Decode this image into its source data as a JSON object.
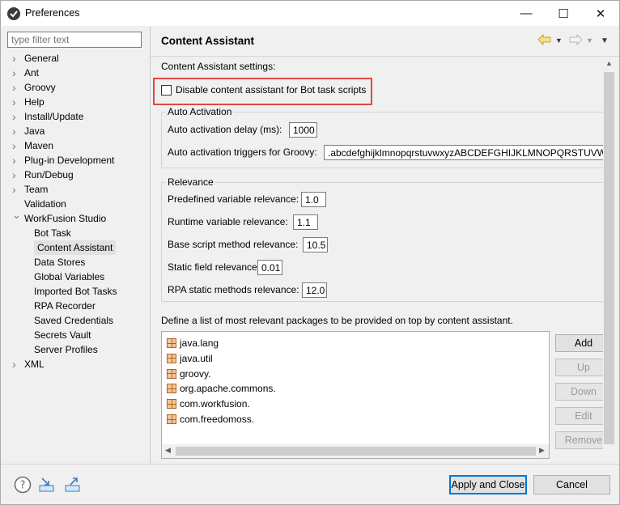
{
  "window": {
    "title": "Preferences",
    "min": "—",
    "max": "☐",
    "close": "✕"
  },
  "sidebar": {
    "filter_placeholder": "type filter text",
    "items": [
      {
        "label": "General",
        "has_children": true
      },
      {
        "label": "Ant",
        "has_children": true
      },
      {
        "label": "Groovy",
        "has_children": true
      },
      {
        "label": "Help",
        "has_children": true
      },
      {
        "label": "Install/Update",
        "has_children": true
      },
      {
        "label": "Java",
        "has_children": true
      },
      {
        "label": "Maven",
        "has_children": true
      },
      {
        "label": "Plug-in Development",
        "has_children": true
      },
      {
        "label": "Run/Debug",
        "has_children": true
      },
      {
        "label": "Team",
        "has_children": true
      },
      {
        "label": "Validation",
        "has_children": false
      },
      {
        "label": "WorkFusion Studio",
        "has_children": true,
        "expanded": true
      },
      {
        "label": "Bot Task",
        "child": true
      },
      {
        "label": "Content Assistant",
        "child": true,
        "selected": true
      },
      {
        "label": "Data Stores",
        "child": true
      },
      {
        "label": "Global Variables",
        "child": true
      },
      {
        "label": "Imported Bot Tasks",
        "child": true
      },
      {
        "label": "RPA Recorder",
        "child": true
      },
      {
        "label": "Saved Credentials",
        "child": true
      },
      {
        "label": "Secrets Vault",
        "child": true
      },
      {
        "label": "Server Profiles",
        "child": true
      },
      {
        "label": "XML",
        "has_children": true
      }
    ]
  },
  "page": {
    "title": "Content Assistant",
    "settings_label": "Content Assistant settings:",
    "disable_checkbox_label": "Disable content assistant for Bot task scripts",
    "disable_checked": false,
    "auto_activation": {
      "group_label": "Auto Activation",
      "delay_label": "Auto activation delay (ms):",
      "delay_value": "1000",
      "triggers_label": "Auto activation triggers for Groovy:",
      "triggers_value": ".abcdefghijklmnopqrstuvwxyzABCDEFGHIJKLMNOPQRSTUVWXYZ"
    },
    "relevance": {
      "group_label": "Relevance",
      "fields": [
        {
          "label": "Predefined variable relevance:",
          "value": "1.0"
        },
        {
          "label": "Runtime variable relevance:",
          "value": "1.1"
        },
        {
          "label": "Base script method relevance:",
          "value": "10.5"
        },
        {
          "label": "Static field relevance:",
          "value": "0.01"
        },
        {
          "label": "RPA static methods relevance:",
          "value": "12.0"
        }
      ]
    },
    "packages_label": "Define a list of most relevant packages to be provided on top by content assistant.",
    "packages": [
      "java.lang",
      "java.util",
      "groovy.",
      "org.apache.commons.",
      "com.workfusion.",
      "com.freedomoss."
    ],
    "buttons": {
      "add": "Add",
      "up": "Up",
      "down": "Down",
      "edit": "Edit",
      "remove": "Remove"
    }
  },
  "footer": {
    "apply_close": "Apply and Close",
    "cancel": "Cancel"
  },
  "colors": {
    "highlight": "#e04848",
    "primary_border": "#0078d7"
  },
  "icons": [
    "help-icon",
    "import-icon",
    "export-icon",
    "back-arrow-icon",
    "forward-arrow-icon",
    "menu-dropdown-icon"
  ]
}
